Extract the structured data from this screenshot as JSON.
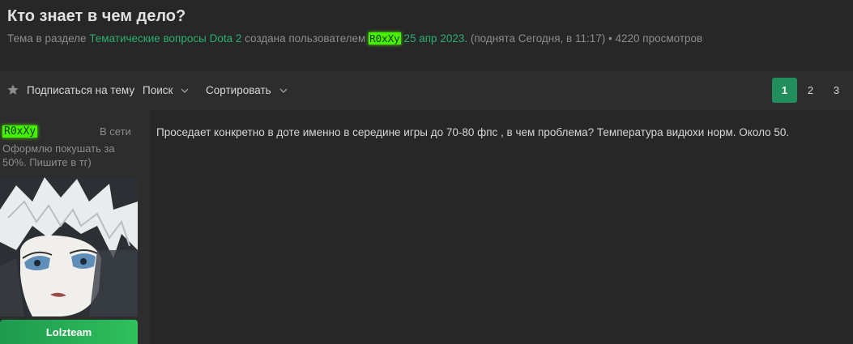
{
  "thread": {
    "title": "Кто знает в чем дело?",
    "meta_prefix": "Тема в разделе ",
    "section": "Тематические вопросы Dota 2",
    "created_by": " создана пользователем ",
    "author": "R0xXy",
    "date": " 25 апр 2023",
    "raised": ". (поднята Сегодня, в 11:17)",
    "views_sep": " • ",
    "views": "4220 просмотров"
  },
  "toolbar": {
    "subscribe_label": "Подписаться на тему",
    "search_label": "Поиск",
    "sort_label": "Сортировать",
    "pages": [
      "1",
      "2",
      "3"
    ],
    "current_page": "1"
  },
  "post": {
    "user": {
      "nickname": "R0xXy",
      "online": "В сети",
      "status": "Оформлю покушать за 50%. Пишите в тг)",
      "group": "Lolzteam"
    },
    "body": "Проседает конкретно в доте именно в середине игры до 70-80 фпс , в чем проблема? Температура видюхи норм. Около 50."
  },
  "colors": {
    "accent": "#2bad72",
    "page_active": "#228e5d",
    "nick_highlight": "#44f200",
    "badge": "#2fc05c"
  }
}
